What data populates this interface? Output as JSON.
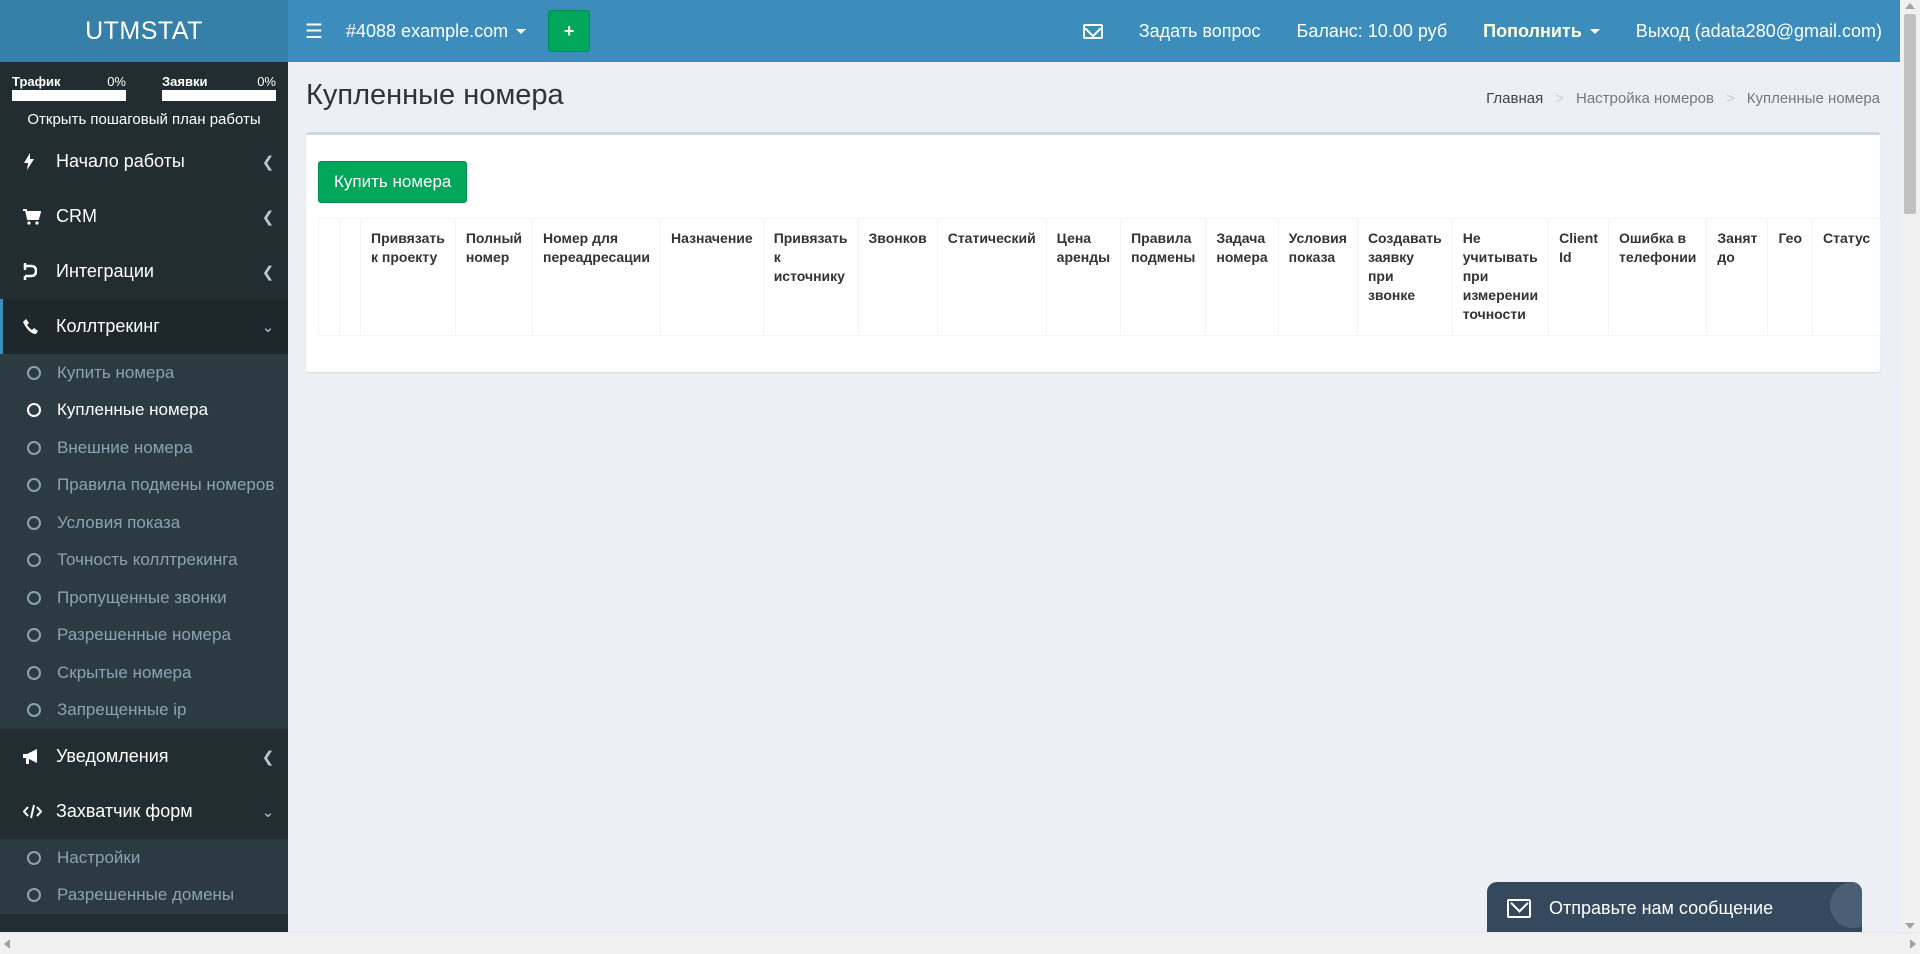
{
  "app": {
    "logo": "UTMSTAT"
  },
  "header": {
    "project": "#4088 example.com",
    "add_button": "+",
    "ask_question": "Задать вопрос",
    "balance": "Баланс: 10.00 руб",
    "topup": "Пополнить",
    "logout": "Выход (adata280@gmail.com)"
  },
  "sidebar": {
    "progress": [
      {
        "label": "Трафик",
        "percent": "0%"
      },
      {
        "label": "Заявки",
        "percent": "0%"
      }
    ],
    "plan_link": "Открыть пошаговый план работы",
    "menu": [
      {
        "label": "Начало работы",
        "icon": "bolt-icon"
      },
      {
        "label": "CRM",
        "icon": "cart-icon"
      },
      {
        "label": "Интеграции",
        "icon": "plug-icon"
      },
      {
        "label": "Коллтрекинг",
        "icon": "phone-icon"
      }
    ],
    "calltracking_items": [
      "Купить номера",
      "Купленные номера",
      "Внешние номера",
      "Правила подмены номеров",
      "Условия показа",
      "Точность коллтрекинга",
      "Пропущенные звонки",
      "Разрешенные номера",
      "Скрытые номера",
      "Запрещенные ip"
    ],
    "menu2": [
      {
        "label": "Уведомления",
        "icon": "megaphone-icon"
      },
      {
        "label": "Захватчик форм",
        "icon": "code-icon"
      }
    ],
    "forms_items": [
      "Настройки",
      "Разрешенные домены"
    ]
  },
  "page": {
    "title": "Купленные номера",
    "breadcrumb": [
      "Главная",
      "Настройка номеров",
      "Купленные номера"
    ],
    "buy_button": "Купить номера"
  },
  "table": {
    "columns": [
      "",
      "",
      "Привязать к проекту",
      "Полный номер",
      "Номер для переадресации",
      "Назначение",
      "Привязать к источнику",
      "Звонков",
      "Статический",
      "Цена аренды",
      "Правила подмены",
      "Задача номера",
      "Условия показа",
      "Создавать заявку при звонке",
      "Не учитывать при измерении точности",
      "Client Id",
      "Ошибка в телефонии",
      "Занят до",
      "Гео",
      "Статус"
    ]
  },
  "chat": {
    "label": "Отправьте нам сообщение"
  },
  "colors": {
    "header": "#3c8dbc",
    "logo_bg": "#367fa9",
    "sidebar": "#222d32",
    "submenu": "#2c3b41",
    "success": "#00a65a",
    "chat": "#34495e"
  }
}
